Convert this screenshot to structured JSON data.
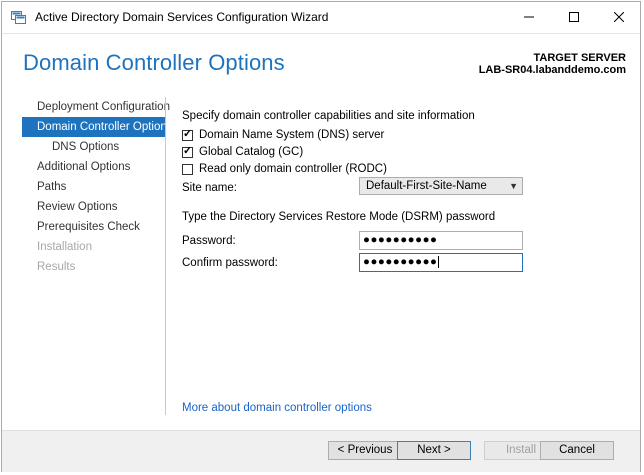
{
  "window": {
    "title": "Active Directory Domain Services Configuration Wizard",
    "min_icon": "minimize-icon",
    "max_icon": "maximize-icon",
    "close_icon": "close-icon"
  },
  "header": {
    "page_title": "Domain Controller Options",
    "target_label": "TARGET SERVER",
    "target_server": "LAB-SR04.labanddemo.com"
  },
  "nav": {
    "items": [
      {
        "label": "Deployment Configuration",
        "state": "normal"
      },
      {
        "label": "Domain Controller Options",
        "state": "active"
      },
      {
        "label": "DNS Options",
        "state": "sub"
      },
      {
        "label": "Additional Options",
        "state": "normal"
      },
      {
        "label": "Paths",
        "state": "normal"
      },
      {
        "label": "Review Options",
        "state": "normal"
      },
      {
        "label": "Prerequisites Check",
        "state": "normal"
      },
      {
        "label": "Installation",
        "state": "disabled"
      },
      {
        "label": "Results",
        "state": "disabled"
      }
    ]
  },
  "main": {
    "capabilities_heading": "Specify domain controller capabilities and site information",
    "checkboxes": [
      {
        "label": "Domain Name System (DNS) server",
        "checked": true
      },
      {
        "label": "Global Catalog (GC)",
        "checked": true
      },
      {
        "label": "Read only domain controller (RODC)",
        "checked": false
      }
    ],
    "site_label": "Site name:",
    "site_value": "Default-First-Site-Name",
    "dsrm_heading": "Type the Directory Services Restore Mode (DSRM) password",
    "password_label": "Password:",
    "password_value": "●●●●●●●●●●",
    "confirm_label": "Confirm password:",
    "confirm_value": "●●●●●●●●●●",
    "more_link": "More about domain controller options"
  },
  "footer": {
    "previous": "< Previous",
    "next": "Next >",
    "install": "Install",
    "cancel": "Cancel"
  },
  "colors": {
    "accent": "#1e73be",
    "link": "#1a64c8"
  }
}
